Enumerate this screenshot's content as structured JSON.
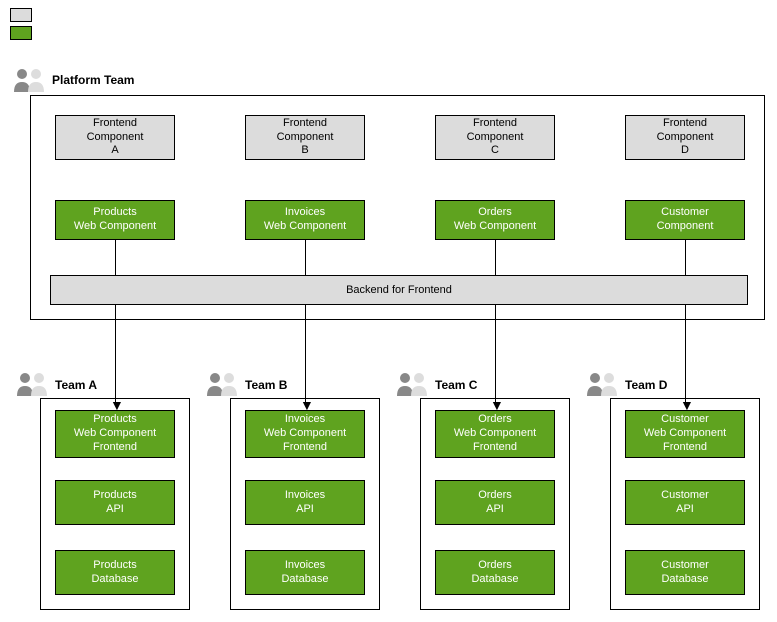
{
  "legend": {
    "platform": "",
    "domain": ""
  },
  "platform": {
    "title": "Platform Team",
    "frontends": [
      {
        "line1": "Frontend",
        "line2": "Component",
        "line3": "A"
      },
      {
        "line1": "Frontend",
        "line2": "Component",
        "line3": "B"
      },
      {
        "line1": "Frontend",
        "line2": "Component",
        "line3": "C"
      },
      {
        "line1": "Frontend",
        "line2": "Component",
        "line3": "D"
      }
    ],
    "web": [
      {
        "line1": "Products",
        "line2": "Web Component"
      },
      {
        "line1": "Invoices",
        "line2": "Web Component"
      },
      {
        "line1": "Orders",
        "line2": "Web Component"
      },
      {
        "line1": "Customer",
        "line2": "Component"
      }
    ],
    "bff": "Backend for Frontend"
  },
  "domains": [
    {
      "team": "Team A",
      "blocks": [
        {
          "line1": "Products",
          "line2": "Web Component",
          "line3": "Frontend"
        },
        {
          "line1": "Products",
          "line2": "API"
        },
        {
          "line1": "Products",
          "line2": "Database"
        }
      ]
    },
    {
      "team": "Team B",
      "blocks": [
        {
          "line1": "Invoices",
          "line2": "Web Component",
          "line3": "Frontend"
        },
        {
          "line1": "Invoices",
          "line2": "API"
        },
        {
          "line1": "Invoices",
          "line2": "Database"
        }
      ]
    },
    {
      "team": "Team C",
      "blocks": [
        {
          "line1": "Orders",
          "line2": "Web Component",
          "line3": "Frontend"
        },
        {
          "line1": "Orders",
          "line2": "API"
        },
        {
          "line1": "Orders",
          "line2": "Database"
        }
      ]
    },
    {
      "team": "Team D",
      "blocks": [
        {
          "line1": "Customer",
          "line2": "Web Component",
          "line3": "Frontend"
        },
        {
          "line1": "Customer",
          "line2": "API"
        },
        {
          "line1": "Customer",
          "line2": "Database"
        }
      ]
    }
  ],
  "colors": {
    "gray": "#dcdcdc",
    "green": "#5fa31f"
  }
}
